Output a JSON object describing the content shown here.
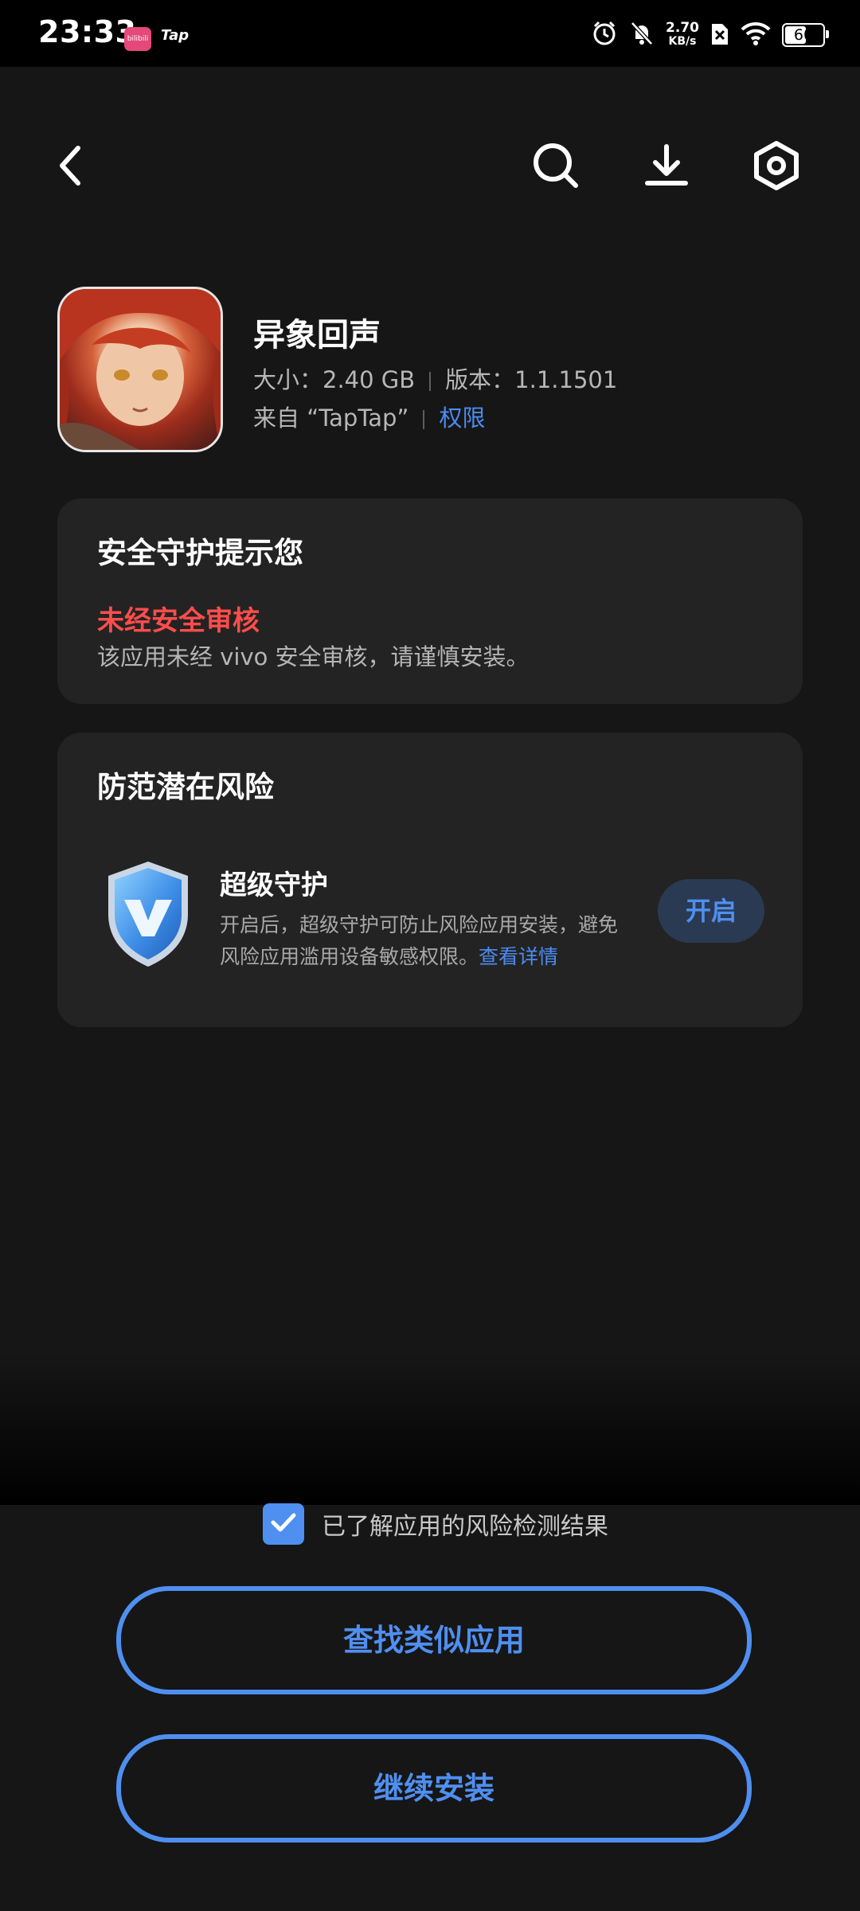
{
  "status_bar": {
    "time": "23:33",
    "app1_badge": "bilibili",
    "app2_badge": "Tap",
    "speed_value": "2.70",
    "speed_unit": "KB/s",
    "battery_level": "60"
  },
  "toolbar": {
    "back_icon": "chevron-left-icon",
    "search_icon": "search-icon",
    "download_icon": "download-icon",
    "settings_icon": "hexagon-settings-icon"
  },
  "app": {
    "name": "异象回声",
    "size_label": "大小：2.40 GB",
    "version_label": "版本：1.1.1501",
    "source_label": "来自 “TapTap”",
    "permissions_link": "权限"
  },
  "security_card": {
    "title": "安全守护提示您",
    "warning_title": "未经安全审核",
    "warning_desc": "该应用未经 vivo 安全审核，请谨慎安装。"
  },
  "risk_card": {
    "title": "防范潜在风险",
    "protection_title": "超级守护",
    "protection_desc": "开启后，超级守护可防止风险应用安装，避免风险应用滥用设备敏感权限。",
    "details_link": "查看详情",
    "enable_label": "开启"
  },
  "footer": {
    "ack_checked": true,
    "ack_label": "已了解应用的风险检测结果",
    "find_similar_label": "查找类似应用",
    "continue_label": "继续安装"
  },
  "colors": {
    "accent": "#4f8ff0",
    "warning": "#ff4c4c",
    "background": "#161616",
    "card": "#232323"
  }
}
